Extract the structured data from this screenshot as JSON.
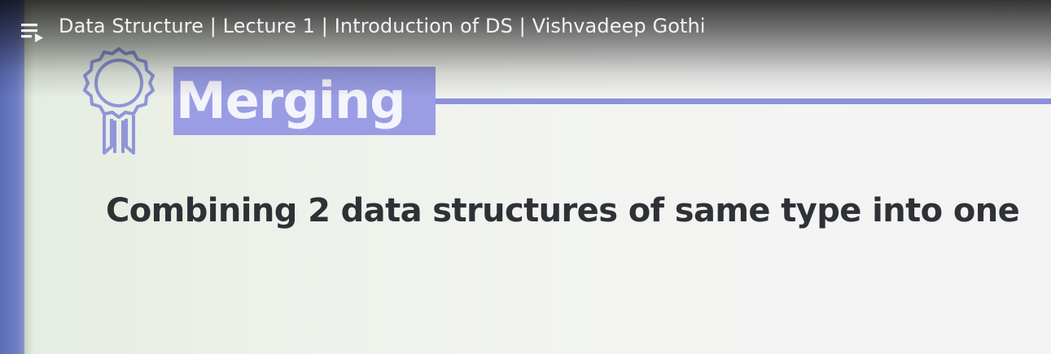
{
  "player": {
    "title": "Data Structure | Lecture 1 | Introduction of DS | Vishvadeep Gothi",
    "playlist_icon": "playlist-icon"
  },
  "slide": {
    "icon": "award-ribbon-icon",
    "heading": "Merging",
    "body": "Combining 2 data structures of same type into one"
  },
  "colors": {
    "accent": "#9a9de4",
    "accent_line": "#8d90dc",
    "left_strip": "#6f7ec4",
    "body_text": "#2e3135",
    "title_text": "#f2f2f2"
  }
}
